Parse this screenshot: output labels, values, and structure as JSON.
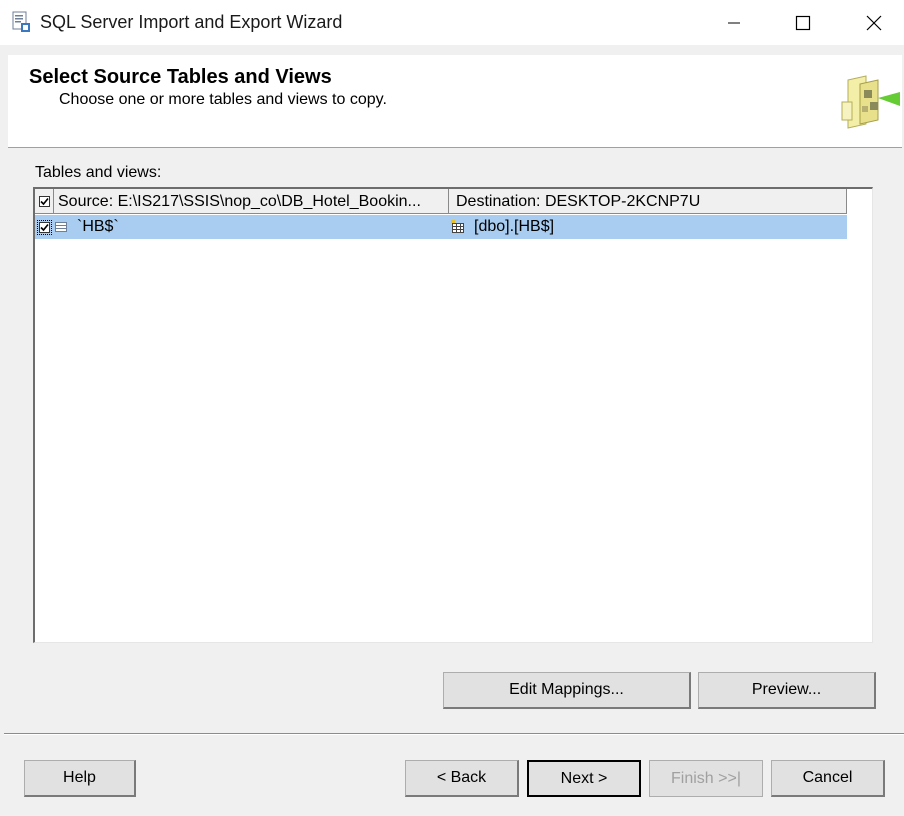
{
  "window": {
    "title": "SQL Server Import and Export Wizard",
    "controls": {
      "minimize": "minimize-icon",
      "maximize": "maximize-icon",
      "close": "close-icon"
    }
  },
  "header": {
    "title": "Select Source Tables and Views",
    "subtitle": "Choose one or more tables and views to copy."
  },
  "tables_label": "Tables and views:",
  "grid": {
    "columns": {
      "source": "Source: E:\\IS217\\SSIS\\nop_co\\DB_Hotel_Bookin...",
      "destination": "Destination: DESKTOP-2KCNP7U"
    },
    "header_checked": true,
    "rows": [
      {
        "checked": true,
        "source": "`HB$`",
        "destination": "[dbo].[HB$]",
        "selected": true
      }
    ]
  },
  "buttons": {
    "edit_mappings": "Edit Mappings...",
    "preview": "Preview...",
    "help": "Help",
    "back": "< Back",
    "next": "Next >",
    "finish": "Finish >>|",
    "cancel": "Cancel"
  },
  "colors": {
    "selection": "#a8cdf0",
    "background": "#f0f0f0"
  }
}
